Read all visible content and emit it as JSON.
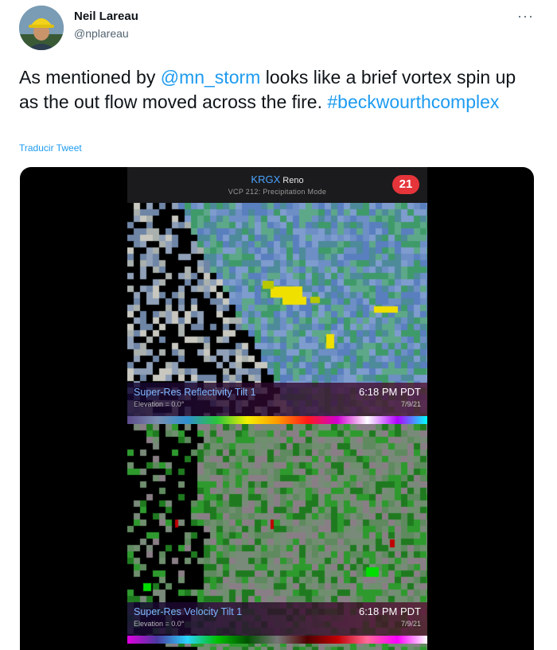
{
  "author": {
    "name": "Neil Lareau",
    "handle": "@nplareau"
  },
  "menu_icon": "more-horizontal-icon",
  "tweet": {
    "text_before": "As mentioned by ",
    "mention": "@mn_storm",
    "text_after": " looks like a brief vortex spin up as the out flow moved across the fire. ",
    "hashtag": "#beckwourthcomplex",
    "translate_label": "Traducir Tweet"
  },
  "radar": {
    "station": "KRGX",
    "city": "Reno",
    "mode": "VCP 212: Precipitation Mode",
    "badge": "21",
    "panels": [
      {
        "product": "Super-Res Reflectivity Tilt 1",
        "elevation": "Elevation = 0.0°",
        "time": "6:18 PM PDT",
        "date": "7/9/21"
      },
      {
        "product": "Super-Res Velocity Tilt 1",
        "elevation": "Elevation = 0.0°",
        "time": "6:18 PM PDT",
        "date": "7/9/21"
      }
    ]
  },
  "colors": {
    "link": "#1d9bf0",
    "badge": "#e5353a",
    "station": "#4aa3ff"
  }
}
